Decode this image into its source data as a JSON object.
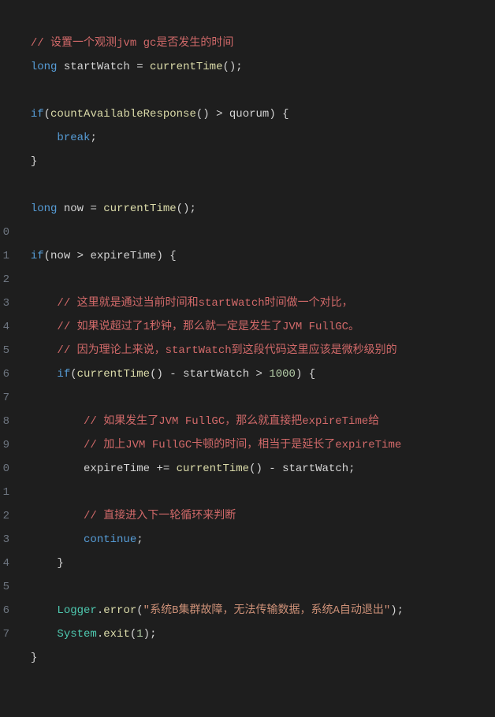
{
  "lineNumbers": [
    "",
    "",
    "",
    "",
    "",
    "",
    "",
    "",
    "",
    "0",
    "1",
    "2",
    "3",
    "4",
    "5",
    "6",
    "7",
    "8",
    "9",
    "0",
    "1",
    "2",
    "3",
    "4",
    "5",
    "6",
    "7"
  ],
  "code": {
    "l1": {
      "indent": "  ",
      "comment": "// 设置一个观测jvm gc是否发生的时间"
    },
    "l2": {
      "indent": "  ",
      "kw": "long",
      "var": " startWatch ",
      "op": "=",
      "fn": " currentTime",
      "punc": "();"
    },
    "l3": "",
    "l4": {
      "indent": "  ",
      "kw": "if",
      "p1": "(",
      "fn": "countAvailableResponse",
      "p2": "() ",
      "op": ">",
      "var": " quorum",
      "p3": ") {"
    },
    "l5": {
      "indent": "      ",
      "kw": "break",
      "punc": ";"
    },
    "l6": {
      "indent": "  ",
      "punc": "}"
    },
    "l7": "",
    "l8": {
      "indent": "  ",
      "kw": "long",
      "var": " now ",
      "op": "=",
      "fn": " currentTime",
      "punc": "();"
    },
    "l9": "",
    "l10": {
      "indent": "  ",
      "kw": "if",
      "p1": "(",
      "var": "now ",
      "op": ">",
      "var2": " expireTime",
      "p2": ") {"
    },
    "l11": "",
    "l12": {
      "indent": "      ",
      "comment": "// 这里就是通过当前时间和startWatch时间做一个对比，"
    },
    "l13": {
      "indent": "      ",
      "comment": "// 如果说超过了1秒钟，那么就一定是发生了JVM FullGC。"
    },
    "l14": {
      "indent": "      ",
      "comment": "// 因为理论上来说，startWatch到这段代码这里应该是微秒级别的"
    },
    "l15": {
      "indent": "      ",
      "kw": "if",
      "p1": "(",
      "fn": "currentTime",
      "p2": "() ",
      "op1": "-",
      "var": " startWatch ",
      "op2": ">",
      "num": " 1000",
      "p3": ") {"
    },
    "l16": "",
    "l17": {
      "indent": "          ",
      "comment": "// 如果发生了JVM FullGC，那么就直接把expireTime给"
    },
    "l18": {
      "indent": "          ",
      "comment": "// 加上JVM FullGC卡顿的时间，相当于是延长了expireTime"
    },
    "l19": {
      "indent": "          ",
      "var": "expireTime ",
      "op1": "+=",
      "fn": " currentTime",
      "p1": "() ",
      "op2": "-",
      "var2": " startWatch",
      "punc": ";"
    },
    "l20": "",
    "l21": {
      "indent": "          ",
      "comment": "// 直接进入下一轮循环来判断"
    },
    "l22": {
      "indent": "          ",
      "kw": "continue",
      "punc": ";"
    },
    "l23": {
      "indent": "      ",
      "punc": "}"
    },
    "l24": "",
    "l25": {
      "indent": "      ",
      "cls": "Logger",
      "p1": ".",
      "fn": "error",
      "p2": "(",
      "str": "\"系统B集群故障，无法传输数据，系统A自动退出\"",
      "p3": ");"
    },
    "l26": {
      "indent": "      ",
      "cls": "System",
      "p1": ".",
      "fn": "exit",
      "p2": "(",
      "num": "1",
      "p3": ");"
    },
    "l27": {
      "indent": "  ",
      "punc": "}"
    }
  }
}
